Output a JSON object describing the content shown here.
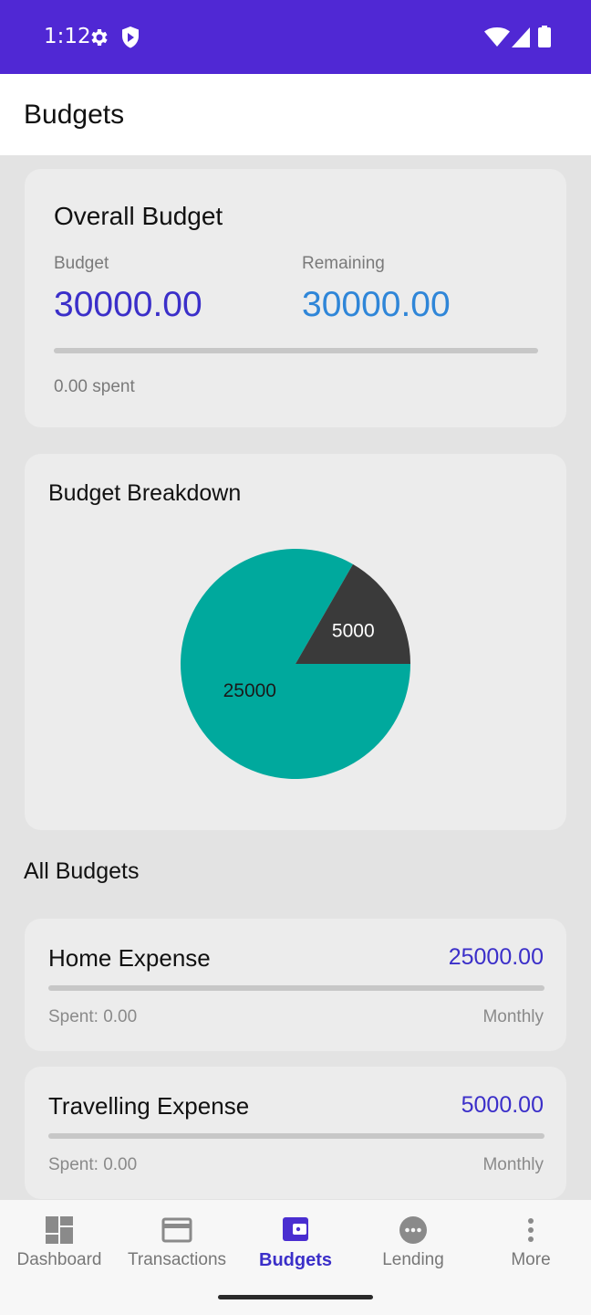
{
  "status_bar": {
    "time": "1:12",
    "icons": [
      "gear-icon",
      "shield-icon",
      "wifi-icon",
      "signal-icon",
      "battery-icon"
    ],
    "color": "#5028d4"
  },
  "app_bar": {
    "title": "Budgets"
  },
  "overall": {
    "title": "Overall Budget",
    "budget_label": "Budget",
    "budget_value": "30000.00",
    "remaining_label": "Remaining",
    "remaining_value": "30000.00",
    "spent_fraction": 0,
    "spent_text": "0.00 spent"
  },
  "breakdown": {
    "title": "Budget Breakdown",
    "chart_data": {
      "type": "pie",
      "values": [
        25000,
        5000
      ],
      "labels": [
        "25000",
        "5000"
      ],
      "colors": [
        "#00a99d",
        "#3a3a3a"
      ]
    }
  },
  "all_budgets": {
    "title": "All Budgets",
    "items": [
      {
        "name": "Home Expense",
        "amount": "25000.00",
        "spent": "Spent: 0.00",
        "period": "Monthly",
        "spent_fraction": 0
      },
      {
        "name": "Travelling Expense",
        "amount": "5000.00",
        "spent": "Spent: 0.00",
        "period": "Monthly",
        "spent_fraction": 0
      }
    ]
  },
  "nav": {
    "items": [
      {
        "label": "Dashboard",
        "icon": "dashboard-icon"
      },
      {
        "label": "Transactions",
        "icon": "card-icon"
      },
      {
        "label": "Budgets",
        "icon": "wallet-icon"
      },
      {
        "label": "Lending",
        "icon": "dots-circle-icon"
      },
      {
        "label": "More",
        "icon": "more-vert-icon"
      }
    ],
    "active_index": 2,
    "active_color": "#3b2fc9"
  }
}
